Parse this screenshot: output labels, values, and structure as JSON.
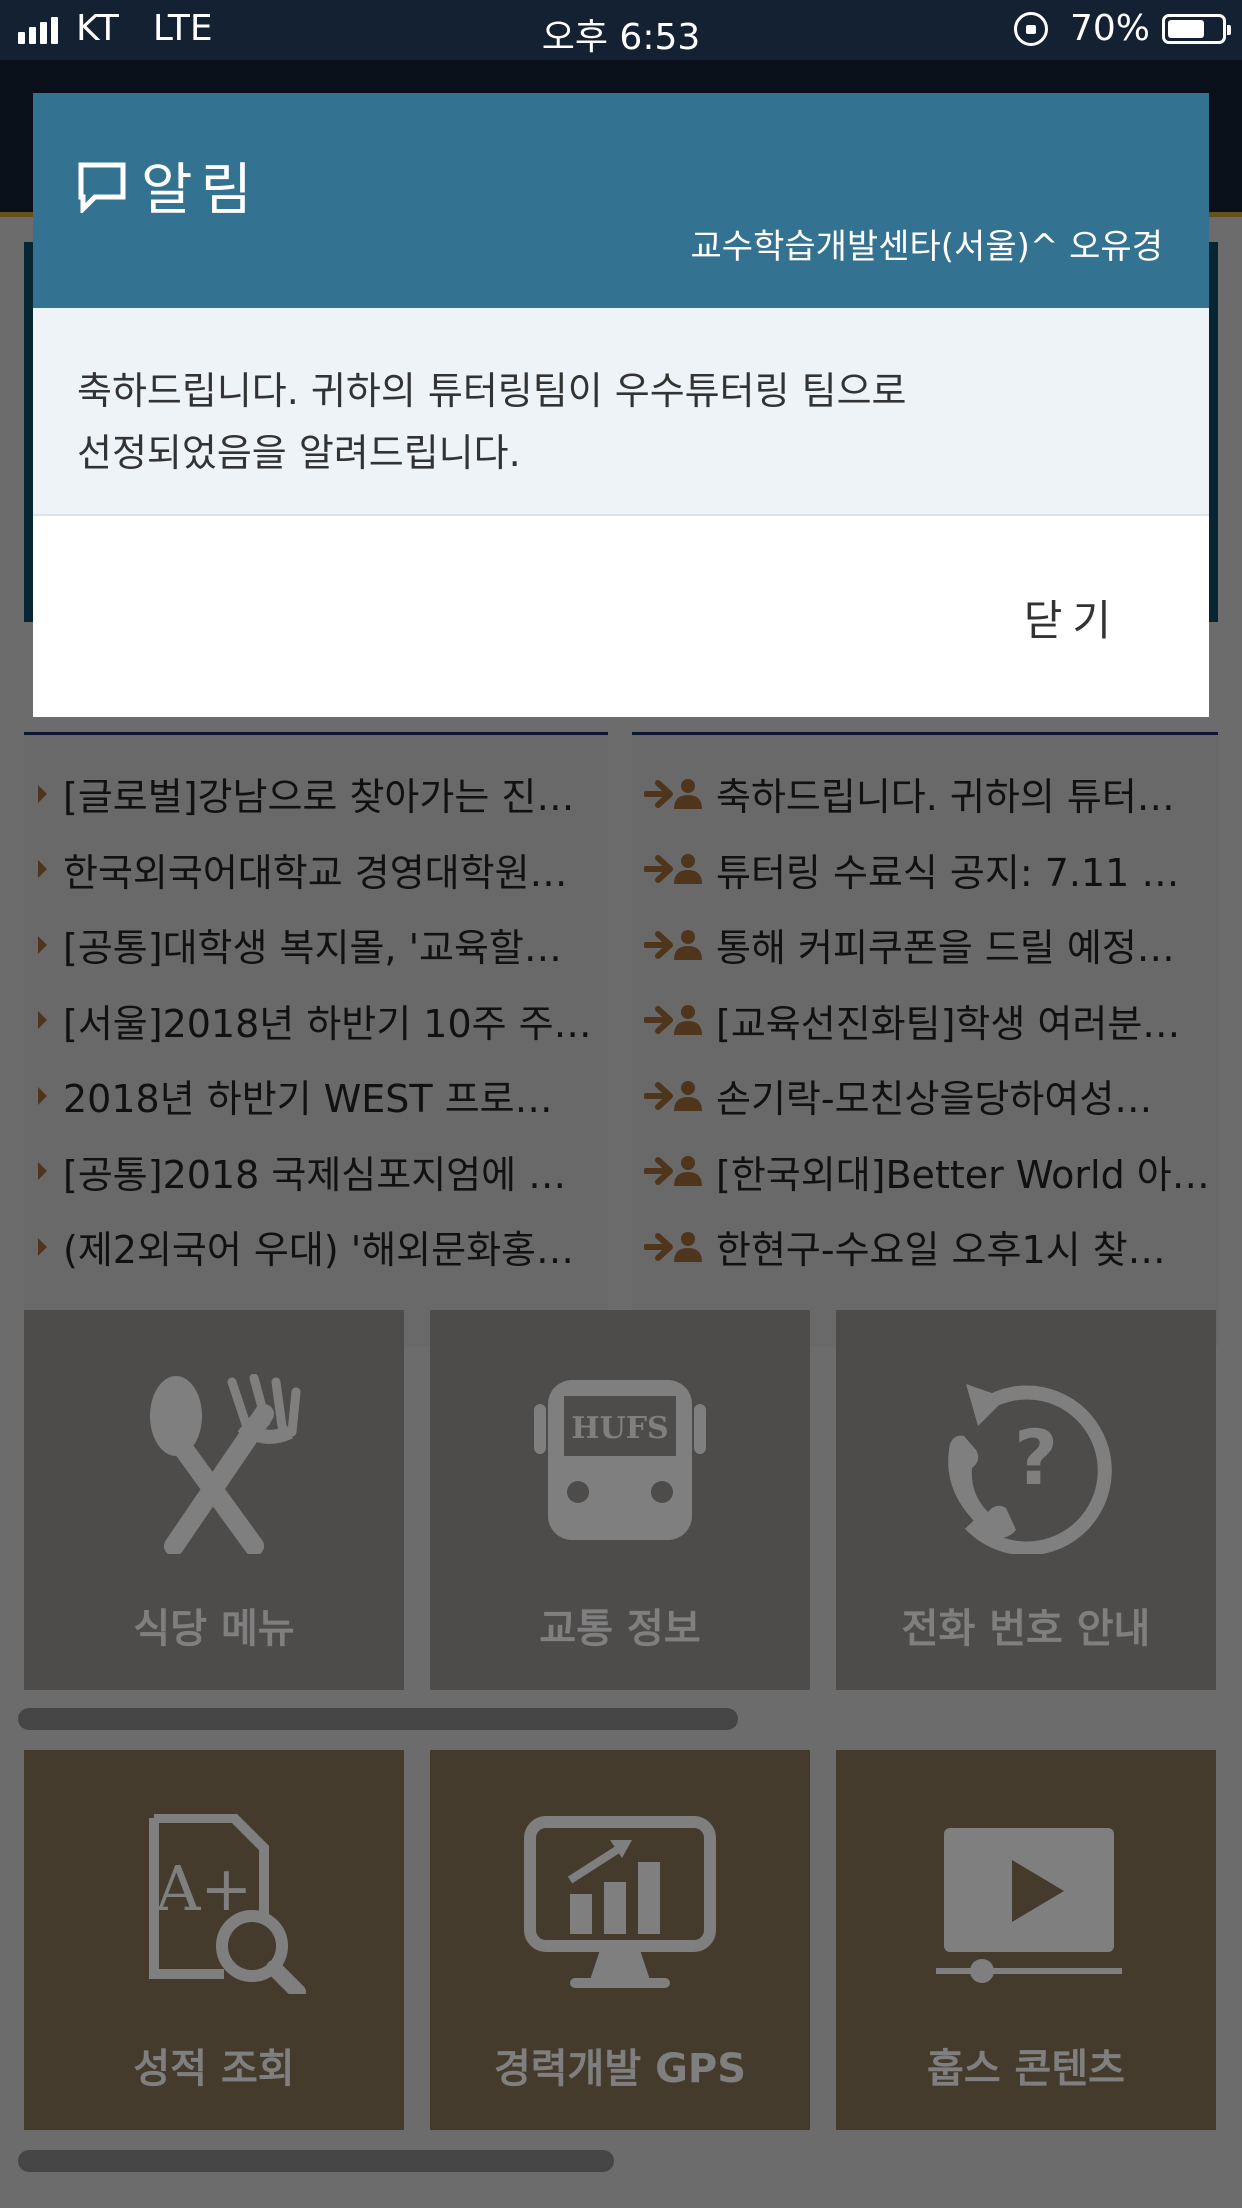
{
  "status_bar": {
    "carrier": "KT",
    "network": "LTE",
    "time": "오후 6:53",
    "battery": "70%",
    "battery_level": 0.7
  },
  "modal": {
    "title": "알림",
    "sender": "교수학습개발센타(서울)^ 오유경",
    "message_line1": "축하드립니다. 귀하의 튜터링팀이 우수튜터링 팀으로",
    "message_line2": "선정되었음을 알려드립니다.",
    "close_label": "닫기"
  },
  "left_list": [
    "[글로벌]강남으로 찾아가는 진로…",
    "한국외국어대학교 경영대학원…",
    "[공통]대학생 복지몰, '교육할…",
    "[서울]2018년 하반기 10주 주…",
    "2018년 하반기 WEST 프로…",
    "[공통]2018 국제심포지엄에 …",
    "(제2외국어 우대) '해외문화홍…"
  ],
  "right_list": [
    "축하드립니다. 귀하의 튜터…",
    "튜터링 수료식 공지: 7.11 …",
    "통해 커피쿠폰을 드릴 예정…",
    "[교육선진화팀]학생 여러분…",
    "손기락-모친상을당하여성…",
    "[한국외대]Better World 아…",
    "한현구-수요일 오후1시 찾…"
  ],
  "tiles": [
    {
      "label": "식당 메뉴",
      "icon": "fork-spoon-icon"
    },
    {
      "label": "교통 정보",
      "icon": "bus-icon",
      "icon_text": "HUFS"
    },
    {
      "label": "전화 번호 안내",
      "icon": "phone-question-icon"
    },
    {
      "label": "성적 조회",
      "icon": "grade-search-icon",
      "icon_text": "A+"
    },
    {
      "label": "경력개발 GPS",
      "icon": "monitor-chart-icon"
    },
    {
      "label": "훕스 콘텐츠",
      "icon": "video-player-icon"
    }
  ],
  "colors": {
    "status_bar": "#142132",
    "modal_header": "#347291",
    "modal_body": "#eef3f8",
    "tile_gray": "#9c9894",
    "tile_brown": "#8b7758"
  }
}
